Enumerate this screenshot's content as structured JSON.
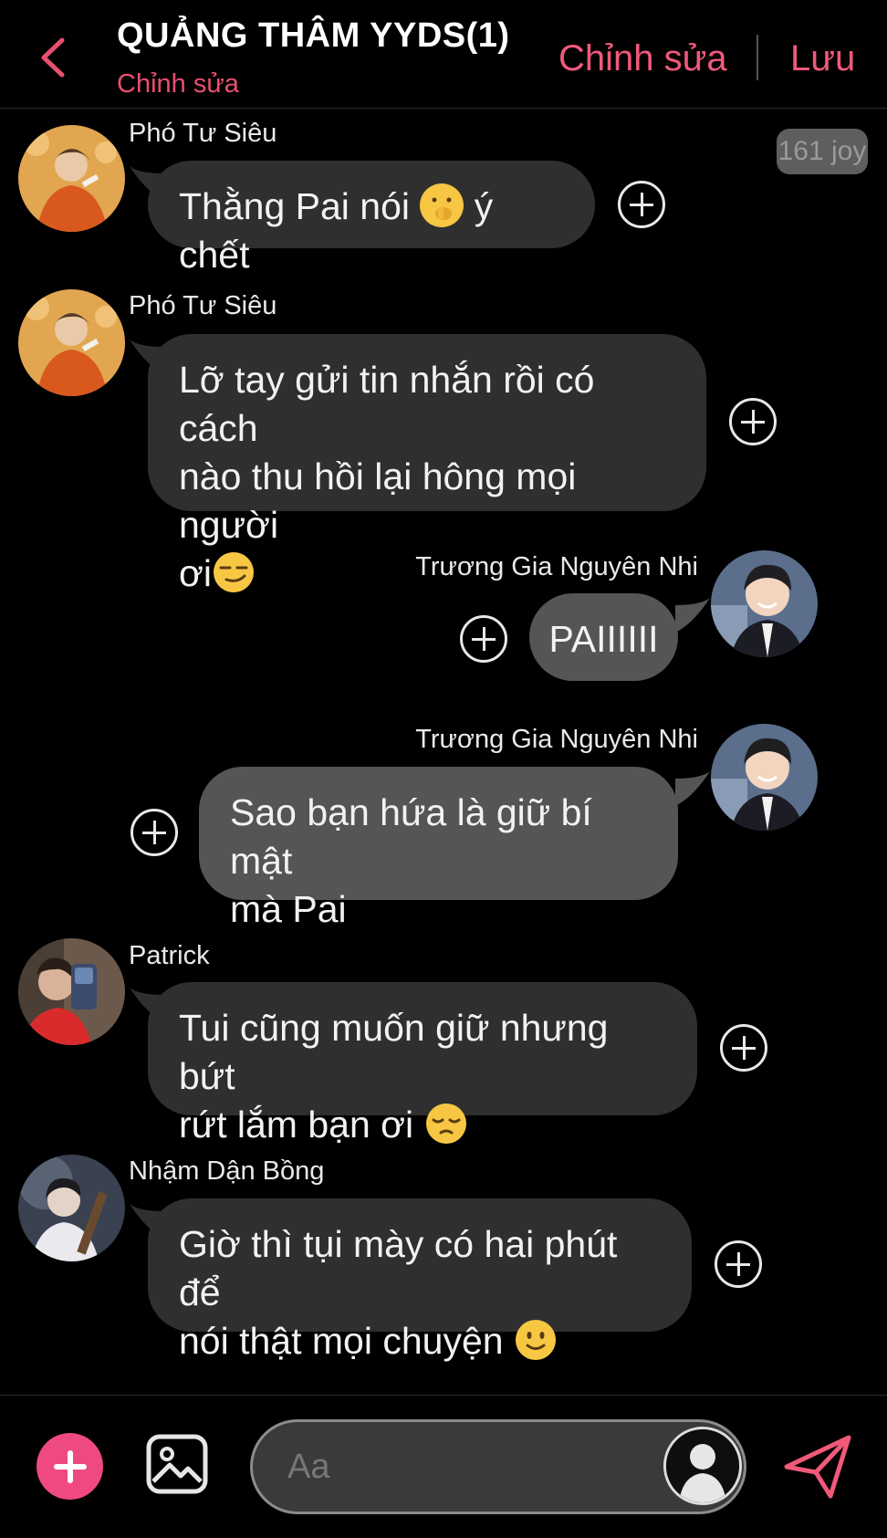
{
  "header": {
    "title": "QUẢNG THÂM YYDS(1)",
    "subtitle": "Chỉnh sửa",
    "edit_label": "Chỉnh sửa",
    "save_label": "Lưu"
  },
  "joy_badge": "161 joy",
  "messages": [
    {
      "sender": "Phó Tư Siêu",
      "side": "left",
      "text_before": "Thằng Pai nói ",
      "emoji": "shushing-face",
      "text_after": " ý chết"
    },
    {
      "sender": "Phó Tư Siêu",
      "side": "left",
      "lines": [
        "Lỡ tay gửi tin nhắn rồi có cách",
        "nào thu hồi lại hông mọi người",
        "ơi"
      ],
      "emoji": "smirking-face"
    },
    {
      "sender": "Trương Gia Nguyên Nhi",
      "side": "right",
      "text": "PAIIIIII"
    },
    {
      "sender": "Trương Gia Nguyên Nhi",
      "side": "right",
      "lines": [
        "Sao bạn hứa là giữ bí mật",
        "mà Pai"
      ]
    },
    {
      "sender": "Patrick",
      "side": "left",
      "lines": [
        "Tui cũng muốn giữ nhưng bứt",
        "rứt lắm bạn ơi "
      ],
      "emoji": "pensive-face"
    },
    {
      "sender": "Nhậm Dận Bồng",
      "side": "left",
      "lines": [
        "Giờ thì tụi mày có hai phút để",
        "nói thật mọi chuyện "
      ],
      "emoji": "slightly-smiling-face"
    }
  ],
  "composer": {
    "placeholder": "Aa"
  },
  "colors": {
    "accent": "#f0597a",
    "bubble_left": "#2f2f2f",
    "bubble_right": "#555555",
    "add_button": "#ef4a7f"
  }
}
